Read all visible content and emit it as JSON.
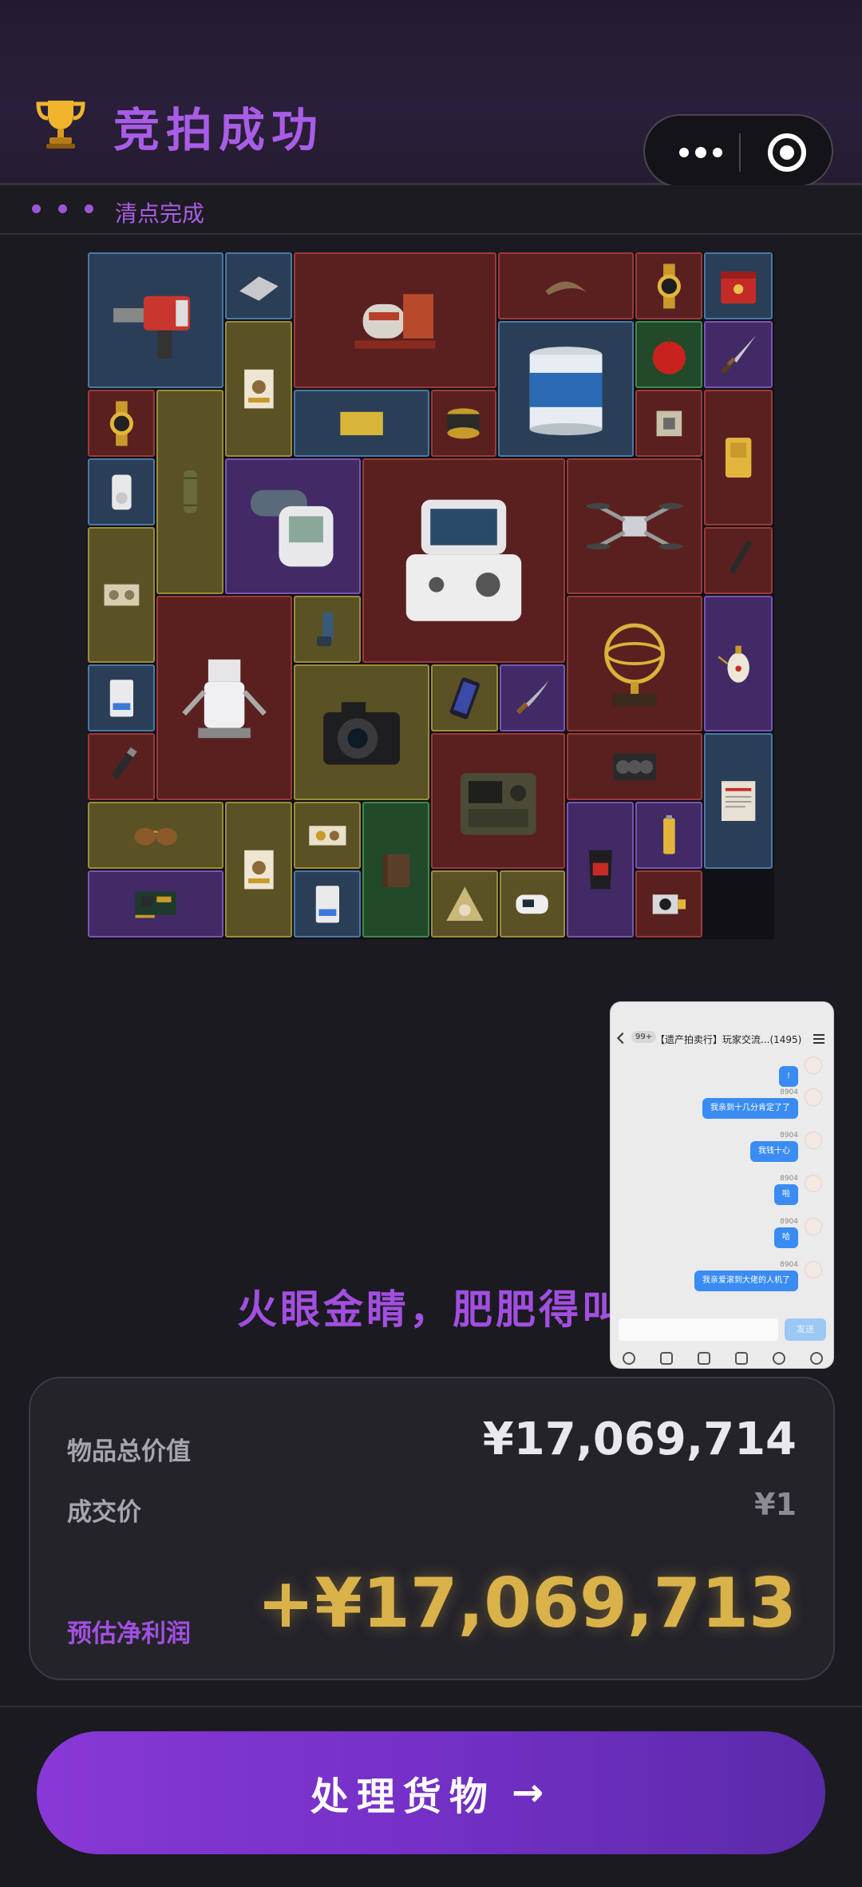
{
  "header": {
    "title": "竞拍成功",
    "trophy_icon": "trophy-icon",
    "capsule": {
      "more_icon": "more-dots-icon",
      "close_icon": "target-close-icon"
    }
  },
  "subbar": {
    "status": "清点完成"
  },
  "items": [
    "electric-hammer-drill",
    "metal-plate",
    "generator-engine",
    "fossil-claw",
    "gold-watch",
    "red-tin-box",
    "boxed-product",
    "paint-bucket-aqua-coat",
    "apple",
    "dagger",
    "gold-watch",
    "tube-case",
    "gold-bar",
    "canister",
    "cpu-chip",
    "gold-ingot",
    "mp3-player",
    "blood-pressure-monitor",
    "medical-ventilator",
    "drone",
    "pen",
    "ancient-scroll",
    "robot-arm",
    "inhaler",
    "armillary-sphere",
    "ornate-teapot",
    "memory-card",
    "camera",
    "smartphone",
    "curved-dagger",
    "marker-pen",
    "military-radio",
    "graphics-card",
    "confidential-document",
    "aviator-sunglasses",
    "boxed-product",
    "chip-box",
    "leather-wallet",
    "snack-bag",
    "battery",
    "circuit-board",
    "memory-card",
    "food-wrap",
    "pulse-oximeter",
    "security-camera"
  ],
  "slogan": "火眼金睛，肥肥得叫",
  "chat_overlay": {
    "badge": "99+",
    "title": "【遗产拍卖行】玩家交流...(1495)",
    "messages": [
      {
        "name": "",
        "text": "!"
      },
      {
        "name": "8904",
        "text": "我亲到十几分肯定了了"
      },
      {
        "name": "8904",
        "text": "我钱十心"
      },
      {
        "name": "8904",
        "text": "啦"
      },
      {
        "name": "8904",
        "text": "哈"
      },
      {
        "name": "8904",
        "text": "我亲爱滚到大佬的人机了"
      }
    ],
    "send_label": "发送"
  },
  "summary": {
    "total_label": "物品总价值",
    "total_value": "¥17,069,714",
    "deal_label": "成交价",
    "deal_value": "¥1",
    "profit_label": "预估净利润",
    "profit_value": "+¥17,069,713"
  },
  "cta": {
    "label": "处理货物",
    "arrow": "→"
  }
}
